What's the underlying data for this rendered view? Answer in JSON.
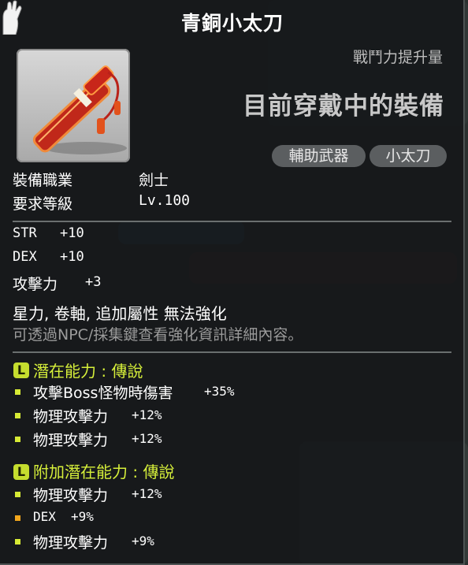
{
  "tooltip": {
    "title": "青銅小太刀",
    "power_label": "戰鬥力提升量",
    "equip_state": "目前穿戴中的裝備",
    "tags": [
      "輔助武器",
      "小太刀"
    ]
  },
  "requirements": [
    {
      "label": "裝備職業",
      "value": "劍士"
    },
    {
      "label": "要求等級",
      "value": "Lv.100"
    }
  ],
  "stats": [
    {
      "name": "STR",
      "value": "+10"
    },
    {
      "name": "DEX",
      "value": "+10"
    },
    {
      "name": "攻擊力",
      "value": "+3"
    }
  ],
  "notes": {
    "restriction": "星力, 卷軸, 追加屬性 無法強化",
    "hint": "可透過NPC/採集鍵查看強化資訊詳細內容。"
  },
  "potential": {
    "badge": "L",
    "heading": "潛在能力 : 傳說",
    "lines": [
      {
        "text": "攻擊Boss怪物時傷害",
        "value": "+35%"
      },
      {
        "text": "物理攻擊力",
        "value": "+12%"
      },
      {
        "text": "物理攻擊力",
        "value": "+12%"
      }
    ]
  },
  "additional_potential": {
    "badge": "L",
    "heading": "附加潛在能力 : 傳說",
    "lines": [
      {
        "text": "物理攻擊力",
        "value": "+12%"
      },
      {
        "text": "DEX",
        "value": "+9%"
      },
      {
        "text": "物理攻擊力",
        "value": "+9%"
      }
    ]
  },
  "colors": {
    "potential_bullet": "#d7ea35",
    "additional_bullet": "#f2a61c",
    "grade_text": "#d6ef3a"
  },
  "icons": {
    "corner": "glove-icon",
    "item": "short-sword-icon"
  }
}
